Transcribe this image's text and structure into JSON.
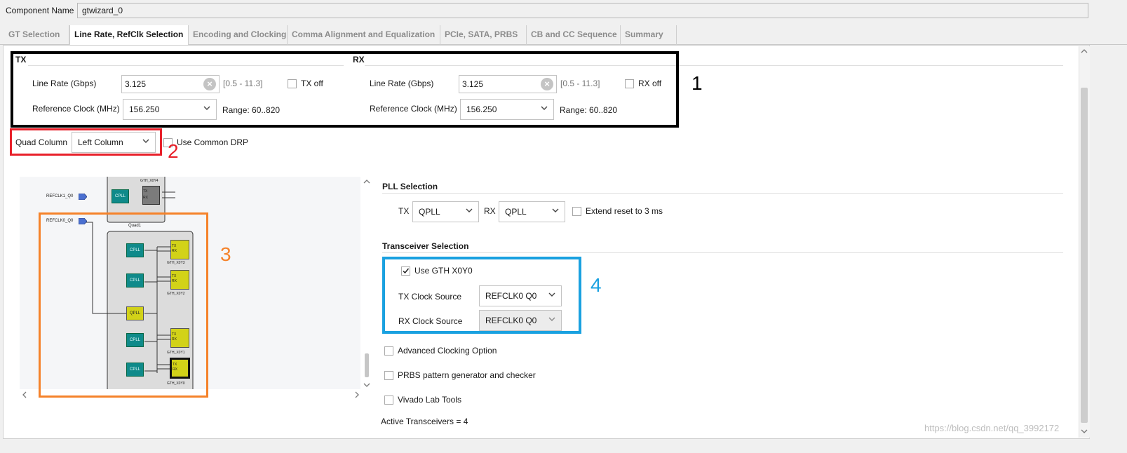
{
  "component": {
    "label": "Component Name",
    "value": "gtwizard_0"
  },
  "tabs": [
    {
      "label": "GT Selection"
    },
    {
      "label": "Line Rate, RefClk Selection"
    },
    {
      "label": "Encoding and Clocking"
    },
    {
      "label": "Comma Alignment and Equalization"
    },
    {
      "label": "PCIe, SATA, PRBS"
    },
    {
      "label": "CB and CC Sequence"
    },
    {
      "label": "Summary"
    }
  ],
  "tx": {
    "title": "TX",
    "line_rate_label": "Line Rate (Gbps)",
    "line_rate_value": "3.125",
    "line_rate_range": "[0.5 - 11.3]",
    "off_label": "TX off",
    "refclk_label": "Reference Clock (MHz)",
    "refclk_value": "156.250",
    "refclk_range": "Range: 60..820"
  },
  "rx": {
    "title": "RX",
    "line_rate_label": "Line Rate (Gbps)",
    "line_rate_value": "3.125",
    "line_rate_range": "[0.5 - 11.3]",
    "off_label": "RX off",
    "refclk_label": "Reference Clock (MHz)",
    "refclk_value": "156.250",
    "refclk_range": "Range: 60..820"
  },
  "quad": {
    "label": "Quad Column",
    "value": "Left Column",
    "common_drp_label": "Use Common DRP"
  },
  "pll": {
    "title": "PLL Selection",
    "tx_label": "TX",
    "tx_value": "QPLL",
    "rx_label": "RX",
    "rx_value": "QPLL",
    "extend_reset_label": "Extend reset to 3 ms"
  },
  "transceiver": {
    "title": "Transceiver Selection",
    "use_gth_label": "Use GTH X0Y0",
    "use_gth_checked": true,
    "tx_clock_label": "TX Clock Source",
    "tx_clock_value": "REFCLK0 Q0",
    "rx_clock_label": "RX Clock Source",
    "rx_clock_value": "REFCLK0 Q0"
  },
  "options": {
    "advanced_clocking": "Advanced Clocking Option",
    "prbs": "PRBS pattern generator and checker",
    "vivado_lab": "Vivado Lab Tools"
  },
  "active_transceivers": "Active Transceivers = 4",
  "annotations": {
    "a1": "1",
    "a2": "2",
    "a3": "3",
    "a4": "4"
  },
  "diagram": {
    "refclk1": "REFCLK1_Q0",
    "refclk0": "REFCLK0_Q0",
    "gth_y4": "GTH_X0Y4",
    "gth_y3": "GTH_X0Y3",
    "gth_y2": "GTH_X0Y2",
    "gth_y1": "GTH_X0Y1",
    "gth_y0": "GTH_X0Y0",
    "quad1": "Quad1",
    "cpll": "CPLL",
    "qpll": "QPLL",
    "tx": "TX",
    "rx": "RX"
  },
  "watermark": "https://blog.csdn.net/qq_3992172",
  "colors": {
    "annot_black": "#000000",
    "annot_red": "#e8202a",
    "annot_orange": "#f5822a",
    "annot_blue": "#1aa1e0",
    "cpll_teal": "#0f8a8a",
    "qpll_yellow": "#d2d218"
  }
}
